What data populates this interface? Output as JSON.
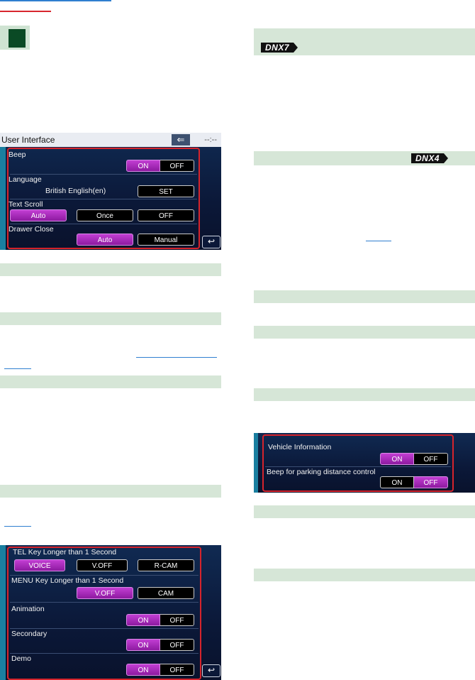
{
  "logos": {
    "dnx7": "DNX7",
    "dnx4": "DNX4"
  },
  "user_interface": {
    "title": "User Interface",
    "time": "--:--",
    "beep": {
      "label": "Beep",
      "on": "ON",
      "off": "OFF"
    },
    "language": {
      "label": "Language",
      "value": "British English(en)",
      "set": "SET"
    },
    "text_scroll": {
      "label": "Text Scroll",
      "auto": "Auto",
      "once": "Once",
      "off": "OFF"
    },
    "drawer_close": {
      "label": "Drawer Close",
      "auto": "Auto",
      "manual": "Manual"
    }
  },
  "key_settings": {
    "tel_key": {
      "label": "TEL Key Longer than 1 Second",
      "voice": "VOICE",
      "voff": "V.OFF",
      "rcam": "R-CAM"
    },
    "menu_key": {
      "label": "MENU Key Longer than 1 Second",
      "voff": "V.OFF",
      "cam": "CAM"
    },
    "animation": {
      "label": "Animation",
      "on": "ON",
      "off": "OFF"
    },
    "secondary": {
      "label": "Secondary",
      "on": "ON",
      "off": "OFF"
    },
    "demo": {
      "label": "Demo",
      "on": "ON",
      "off": "OFF"
    }
  },
  "vehicle": {
    "vehicle_info": {
      "label": "Vehicle Information",
      "on": "ON",
      "off": "OFF"
    },
    "beep_parking": {
      "label": "Beep for parking distance control",
      "on": "ON",
      "off": "OFF"
    }
  },
  "accent_colors": {
    "active": "#b02fc4",
    "frame": "#d6242c",
    "bar": "#d6e6d7"
  }
}
